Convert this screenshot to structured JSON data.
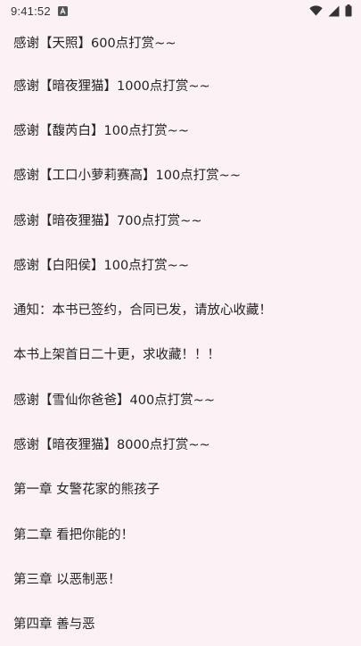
{
  "status_bar": {
    "time": "9:41:52",
    "icons": [
      "notification-a-icon",
      "wifi-icon",
      "signal-icon",
      "battery-icon"
    ]
  },
  "chapters": [
    {
      "title": "感谢【天照】600点打赏~~"
    },
    {
      "title": "感谢【暗夜狸猫】1000点打赏~~"
    },
    {
      "title": "感谢【馥芮白】100点打赏~~"
    },
    {
      "title": "感谢【工口小萝莉赛高】100点打赏~~"
    },
    {
      "title": "感谢【暗夜狸猫】700点打赏~~"
    },
    {
      "title": "感谢【白阳侯】100点打赏~~"
    },
    {
      "title": "通知：本书已签约，合同已发，请放心收藏！"
    },
    {
      "title": "本书上架首日二十更，求收藏！！！"
    },
    {
      "title": "感谢【雪仙你爸爸】400点打赏~~"
    },
    {
      "title": "感谢【暗夜狸猫】8000点打赏~~"
    },
    {
      "title": "第一章 女警花家的熊孩子"
    },
    {
      "title": "第二章 看把你能的！"
    },
    {
      "title": "第三章 以恶制恶！"
    },
    {
      "title": "第四章 善与恶"
    }
  ]
}
